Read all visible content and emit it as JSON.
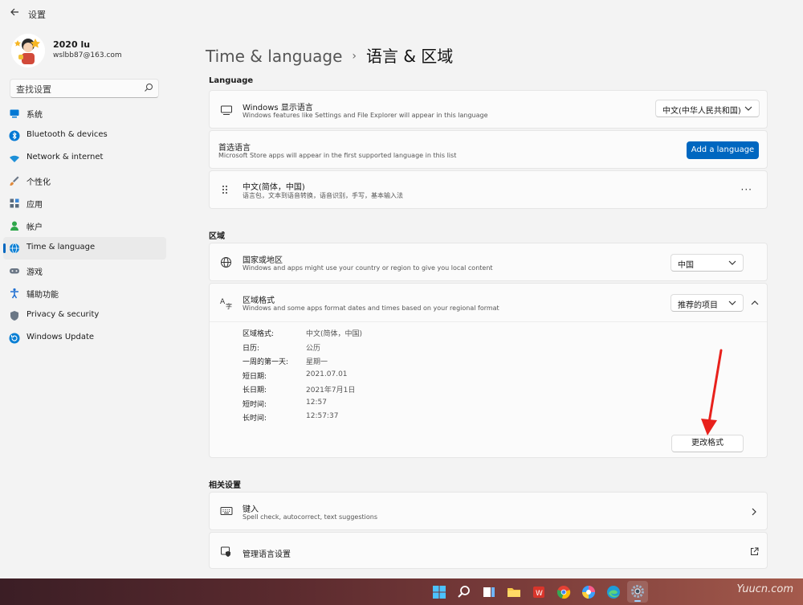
{
  "window": {
    "title": "设置"
  },
  "user": {
    "name": "2020 lu",
    "email": "wslbb87@163.com"
  },
  "search": {
    "placeholder": "查找设置"
  },
  "nav": [
    {
      "label": "系统",
      "icon": "monitor-icon",
      "color": "#0078d4"
    },
    {
      "label": "Bluetooth & devices",
      "icon": "bluetooth-icon",
      "color": "#0078d4"
    },
    {
      "label": "Network & internet",
      "icon": "wifi-icon",
      "color": "#1e90d8"
    },
    {
      "label": "个性化",
      "icon": "brush-icon",
      "color": "#e08a3c"
    },
    {
      "label": "应用",
      "icon": "apps-icon",
      "color": "#5a6b7d"
    },
    {
      "label": "帐户",
      "icon": "person-icon",
      "color": "#2ea64a"
    },
    {
      "label": "Time & language",
      "icon": "globe-clock-icon",
      "color": "#0a7fd4",
      "active": true
    },
    {
      "label": "游戏",
      "icon": "gamepad-icon",
      "color": "#6b7786"
    },
    {
      "label": "辅助功能",
      "icon": "accessibility-icon",
      "color": "#1f6fd1"
    },
    {
      "label": "Privacy & security",
      "icon": "shield-icon",
      "color": "#6b7786"
    },
    {
      "label": "Windows Update",
      "icon": "update-icon",
      "color": "#0a7fd4"
    }
  ],
  "breadcrumb": {
    "parent": "Time & language",
    "separator": "›",
    "current": "语言 & 区域"
  },
  "language": {
    "heading": "Language",
    "display": {
      "title": "Windows 显示语言",
      "subtitle": "Windows features like Settings and File Explorer will appear in this language",
      "value": "中文(中华人民共和国)"
    },
    "preferred": {
      "title": "首选语言",
      "subtitle": "Microsoft Store apps will appear in the first supported language in this list",
      "button": "Add a language"
    },
    "installed": {
      "title": "中文(简体，中国)",
      "subtitle": "语言包，文本到语音转换，语音识别，手写，基本输入法",
      "more": "···"
    }
  },
  "region": {
    "heading": "区域",
    "country": {
      "title": "国家或地区",
      "subtitle": "Windows and apps might use your country or region to give you local content",
      "value": "中国"
    },
    "format": {
      "title": "区域格式",
      "subtitle": "Windows and some apps format dates and times based on your regional format",
      "value": "推荐的项目",
      "details": [
        {
          "label": "区域格式:",
          "value": "中文(简体，中国)"
        },
        {
          "label": "日历:",
          "value": "公历"
        },
        {
          "label": "一周的第一天:",
          "value": "星期一"
        },
        {
          "label": "短日期:",
          "value": "2021.07.01"
        },
        {
          "label": "长日期:",
          "value": "2021年7月1日"
        },
        {
          "label": "短时间:",
          "value": "12:57"
        },
        {
          "label": "长时间:",
          "value": "12:57:37"
        }
      ],
      "change_button": "更改格式"
    }
  },
  "related": {
    "heading": "相关设置",
    "typing": {
      "title": "键入",
      "subtitle": "Spell check, autocorrect, text suggestions"
    },
    "admin": {
      "title": "管理语言设置"
    }
  },
  "watermark": "Yuucn.com",
  "colors": {
    "accent": "#0067c0",
    "annotation": "#e8211c"
  }
}
